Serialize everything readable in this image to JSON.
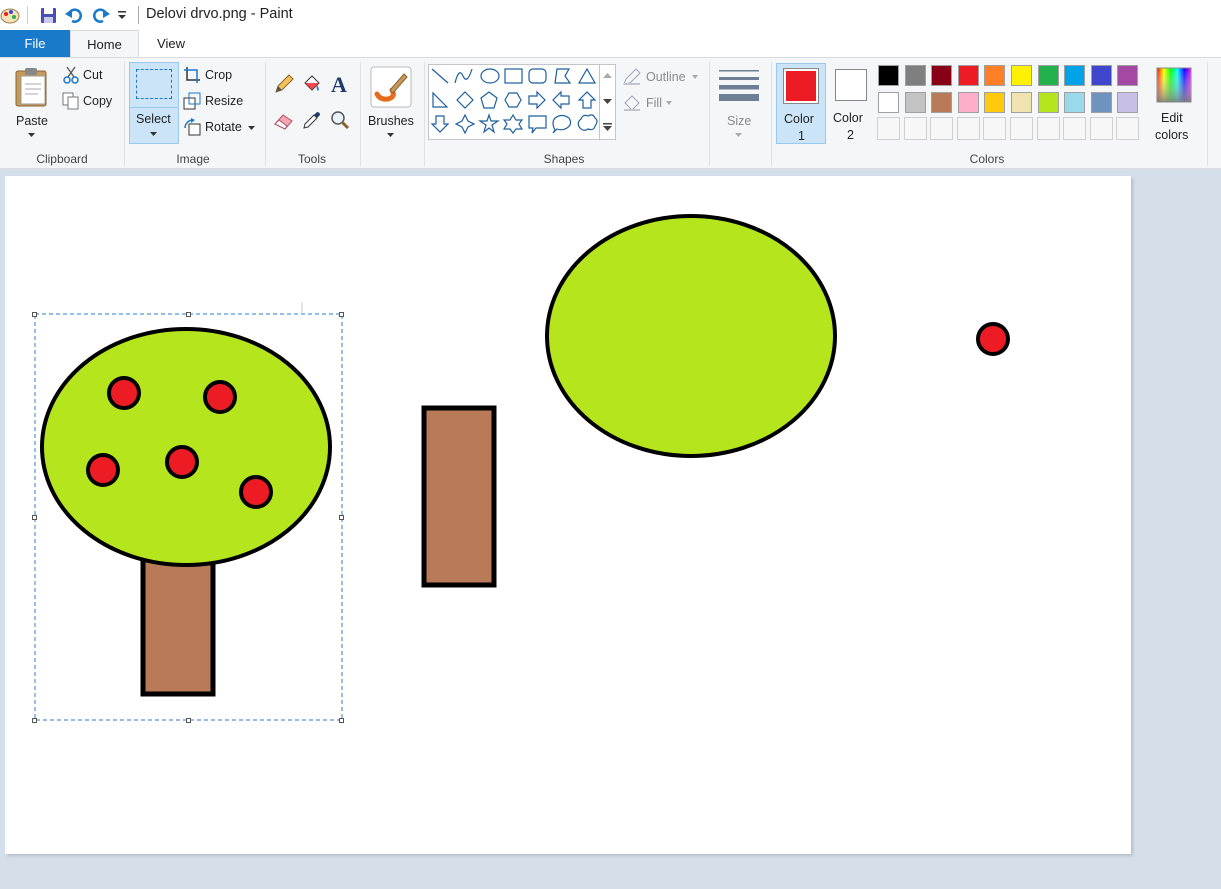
{
  "window": {
    "title": "Delovi drvo.png - Paint"
  },
  "tabs": [
    {
      "label": "File"
    },
    {
      "label": "Home"
    },
    {
      "label": "View"
    }
  ],
  "clipboard": {
    "paste": "Paste",
    "cut": "Cut",
    "copy": "Copy",
    "group": "Clipboard"
  },
  "image": {
    "select": "Select",
    "crop": "Crop",
    "resize": "Resize",
    "rotate": "Rotate",
    "group": "Image"
  },
  "tools": {
    "group": "Tools"
  },
  "brushes": {
    "label": "Brushes"
  },
  "shapes": {
    "outline": "Outline",
    "fill": "Fill",
    "group": "Shapes"
  },
  "size": {
    "label": "Size"
  },
  "colors": {
    "color1_label": "Color",
    "color1_num": "1",
    "color2_label": "Color",
    "color2_num": "2",
    "edit_label_1": "Edit",
    "edit_label_2": "colors",
    "group": "Colors",
    "color1_value": "#ed1c24",
    "color2_value": "#ffffff",
    "palette_row1": [
      "#000000",
      "#7f7f7f",
      "#880015",
      "#ed1c24",
      "#ff7f27",
      "#fff200",
      "#22b14c",
      "#00a2e8",
      "#3f48cc",
      "#a349a4"
    ],
    "palette_row2": [
      "#ffffff",
      "#c3c3c3",
      "#b97a57",
      "#ffaec9",
      "#ffc90e",
      "#efe4b0",
      "#b5e61d",
      "#99d9ea",
      "#7092be",
      "#c8bfe7"
    ]
  },
  "drawing": {
    "foliage_color": "#b5e61d",
    "fruit_color": "#ed1c24",
    "trunk_color": "#b97a57",
    "outline_color": "#000000"
  }
}
